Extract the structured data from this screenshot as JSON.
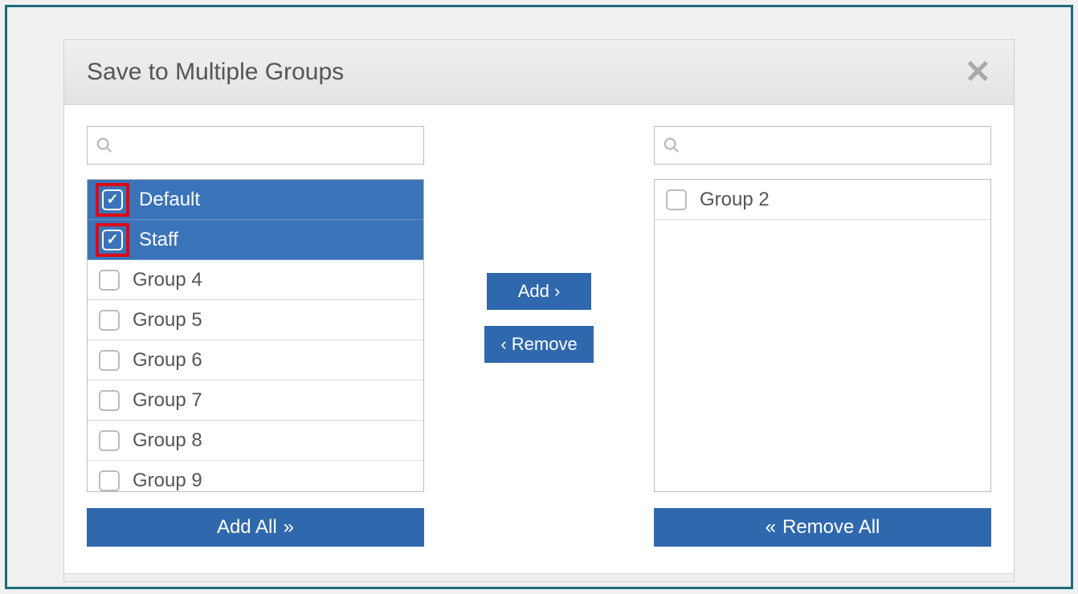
{
  "dialog": {
    "title": "Save to Multiple Groups"
  },
  "left": {
    "search_placeholder": "",
    "search_value": "",
    "items": [
      {
        "label": "Default",
        "checked": true,
        "highlighted": true
      },
      {
        "label": "Staff",
        "checked": true,
        "highlighted": true
      },
      {
        "label": "Group 4",
        "checked": false,
        "highlighted": false
      },
      {
        "label": "Group 5",
        "checked": false,
        "highlighted": false
      },
      {
        "label": "Group 6",
        "checked": false,
        "highlighted": false
      },
      {
        "label": "Group 7",
        "checked": false,
        "highlighted": false
      },
      {
        "label": "Group 8",
        "checked": false,
        "highlighted": false
      },
      {
        "label": "Group 9",
        "checked": false,
        "highlighted": false
      }
    ],
    "add_all_label": "Add All"
  },
  "middle": {
    "add_label": "Add",
    "remove_label": "Remove"
  },
  "right": {
    "search_placeholder": "",
    "search_value": "",
    "items": [
      {
        "label": "Group 2",
        "checked": false,
        "highlighted": false
      }
    ],
    "remove_all_label": "Remove All"
  }
}
